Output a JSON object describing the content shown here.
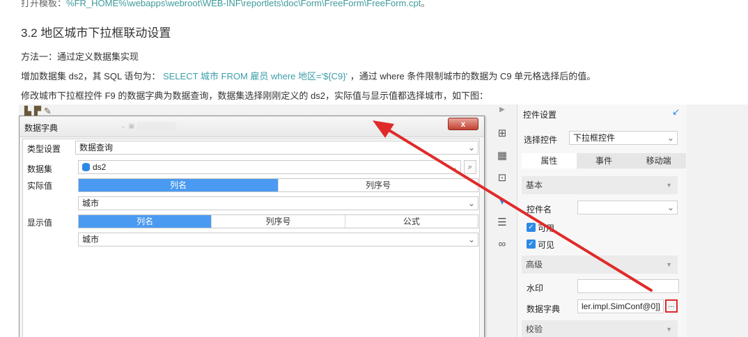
{
  "doc": {
    "topline_prefix": "打开模板：",
    "topline_path": "%FR_HOME%\\webapps\\webroot\\WEB-INF\\reportlets\\doc\\Form\\FreeForm\\FreeForm.cpt",
    "topline_suffix": "。",
    "section_title": "3.2 地区城市下拉框联动设置",
    "method": "方法一：通过定义数据集实现",
    "p2_before": "增加数据集 ds2，其 SQL 语句为：",
    "p2_code": "SELECT 城市 FROM 雇员 where 地区='${C9}'",
    "p2_after": "，通过 where 条件限制城市的数据为 C9 单元格选择后的值。",
    "p3": "修改城市下拉框控件 F9 的数据字典为数据查询，数据集选择刚刚定义的 ds2，实际值与显示值都选择城市，如下图："
  },
  "dialog": {
    "title": "数据字典",
    "close_label": "x",
    "type_label": "类型设置",
    "type_value": "数据查询",
    "dataset_label": "数据集",
    "dataset_value": "ds2",
    "actual_label": "实际值",
    "actual_tabs": [
      "列名",
      "列序号"
    ],
    "actual_value": "城市",
    "display_label": "显示值",
    "display_tabs": [
      "列名",
      "列序号",
      "公式"
    ],
    "display_value": "城市"
  },
  "strip_icons": [
    "play-icon",
    "form-icon",
    "info-icon",
    "frame-icon",
    "widget-icon",
    "list-icon",
    "link-icon"
  ],
  "panel": {
    "title": "控件设置",
    "select_label": "选择控件",
    "select_value": "下拉框控件",
    "tabs": [
      "属性",
      "事件",
      "移动端"
    ],
    "basic": "基本",
    "widget_name_label": "控件名",
    "enabled_label": "可用",
    "visible_label": "可见",
    "advanced": "高级",
    "watermark_label": "水印",
    "dict_label": "数据字典",
    "dict_value": "ler.impl.SimConf@0]]",
    "dots": "...",
    "validate": "校验"
  },
  "colors": {
    "accent": "#4a9af2",
    "arrow": "#e02a2a",
    "code": "#3d9ea9"
  }
}
